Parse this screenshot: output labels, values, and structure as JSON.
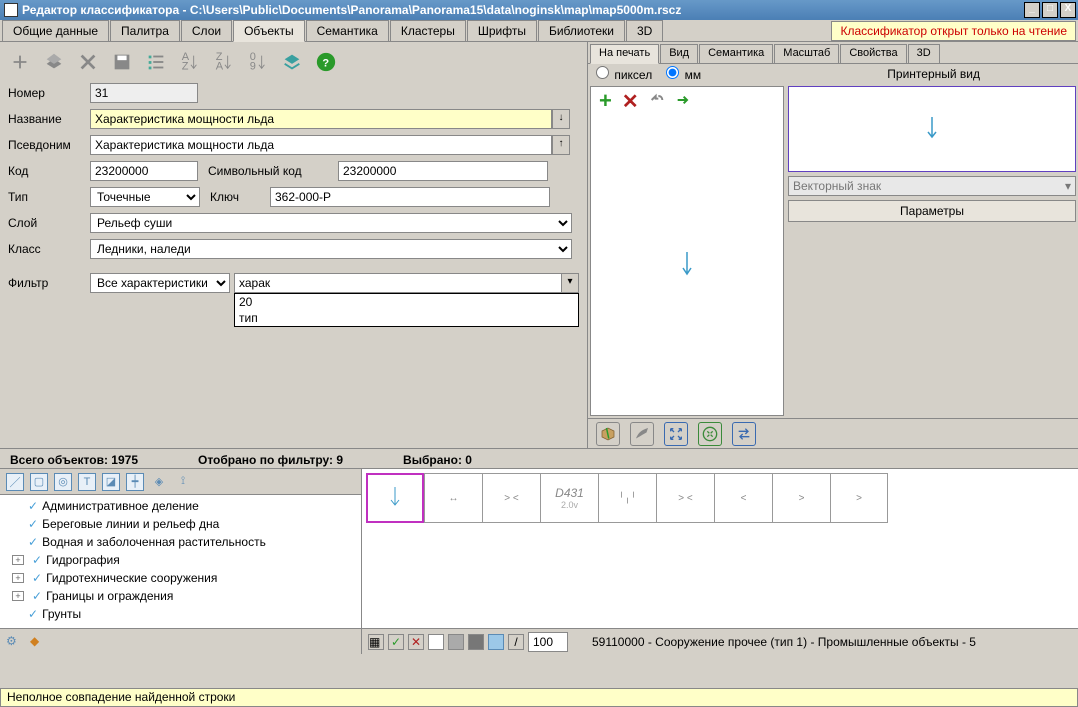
{
  "window": {
    "title": "Редактор классификатора - C:\\Users\\Public\\Documents\\Panorama\\Panorama15\\data\\noginsk\\map\\map5000m.rscz",
    "readonly_badge": "Классификатор открыт только на чтение"
  },
  "main_tabs": [
    "Общие данные",
    "Палитра",
    "Слои",
    "Объекты",
    "Семантика",
    "Кластеры",
    "Шрифты",
    "Библиотеки",
    "3D"
  ],
  "main_tab_active": 3,
  "form": {
    "number_label": "Номер",
    "number": "31",
    "name_label": "Название",
    "name": "Характеристика мощности льда",
    "alias_label": "Псевдоним",
    "alias": "Характеристика мощности льда",
    "code_label": "Код",
    "code": "23200000",
    "symcode_label": "Символьный код",
    "symcode": "23200000",
    "type_label": "Тип",
    "type": "Точечные",
    "key_label": "Ключ",
    "key": "362-000-P",
    "layer_label": "Слой",
    "layer": " Рельеф суши",
    "class_label": "Класс",
    "class": "  Ледники, наледи",
    "filter_label": "Фильтр",
    "filter_mode": "Все характеристики",
    "filter_text": "харак",
    "filter_dropdown": [
      "20",
      "тип"
    ]
  },
  "stats": {
    "total_label": "Всего объектов: ",
    "total": "1975",
    "filtered_label": "Отобрано по фильтру: ",
    "filtered": "9",
    "selected_label": "Выбрано: ",
    "selected": "0"
  },
  "tree": {
    "items": [
      {
        "exp": true,
        "label": "Административное деление"
      },
      {
        "exp": true,
        "label": "Береговые линии и рельеф дна"
      },
      {
        "exp": true,
        "label": "Водная и заболоченная растительность"
      },
      {
        "exp": true,
        "label": "Гидрография",
        "box": true
      },
      {
        "exp": true,
        "label": "Гидротехнические сооружения",
        "box": true
      },
      {
        "exp": true,
        "label": "Границы и ограждения",
        "box": true
      },
      {
        "exp": true,
        "label": "Грунты"
      }
    ]
  },
  "thumbs": {
    "items": [
      {
        "kind": "arrow-down",
        "sel": true
      },
      {
        "kind": "hline"
      },
      {
        "kind": "angles1"
      },
      {
        "code": "D431",
        "sub": "2.0v"
      },
      {
        "kind": "marks"
      },
      {
        "kind": "angles2"
      },
      {
        "kind": "lt"
      },
      {
        "kind": "gt"
      },
      {
        "kind": "gt"
      }
    ],
    "footer_code": "100",
    "footer_text": "59110000 - Сооружение прочее (тип 1) - Промышленные объекты - 5"
  },
  "right": {
    "tabs": [
      "На печать",
      "Вид",
      "Семантика",
      "Масштаб",
      "Свойства",
      "3D"
    ],
    "tab_active": 0,
    "unit_pixel": "пиксел",
    "unit_mm": "мм",
    "preview_title": "Принтерный вид",
    "vector_sign": "Векторный знак",
    "params_btn": "Параметры"
  },
  "status": "Неполное совпадение найденной строки"
}
